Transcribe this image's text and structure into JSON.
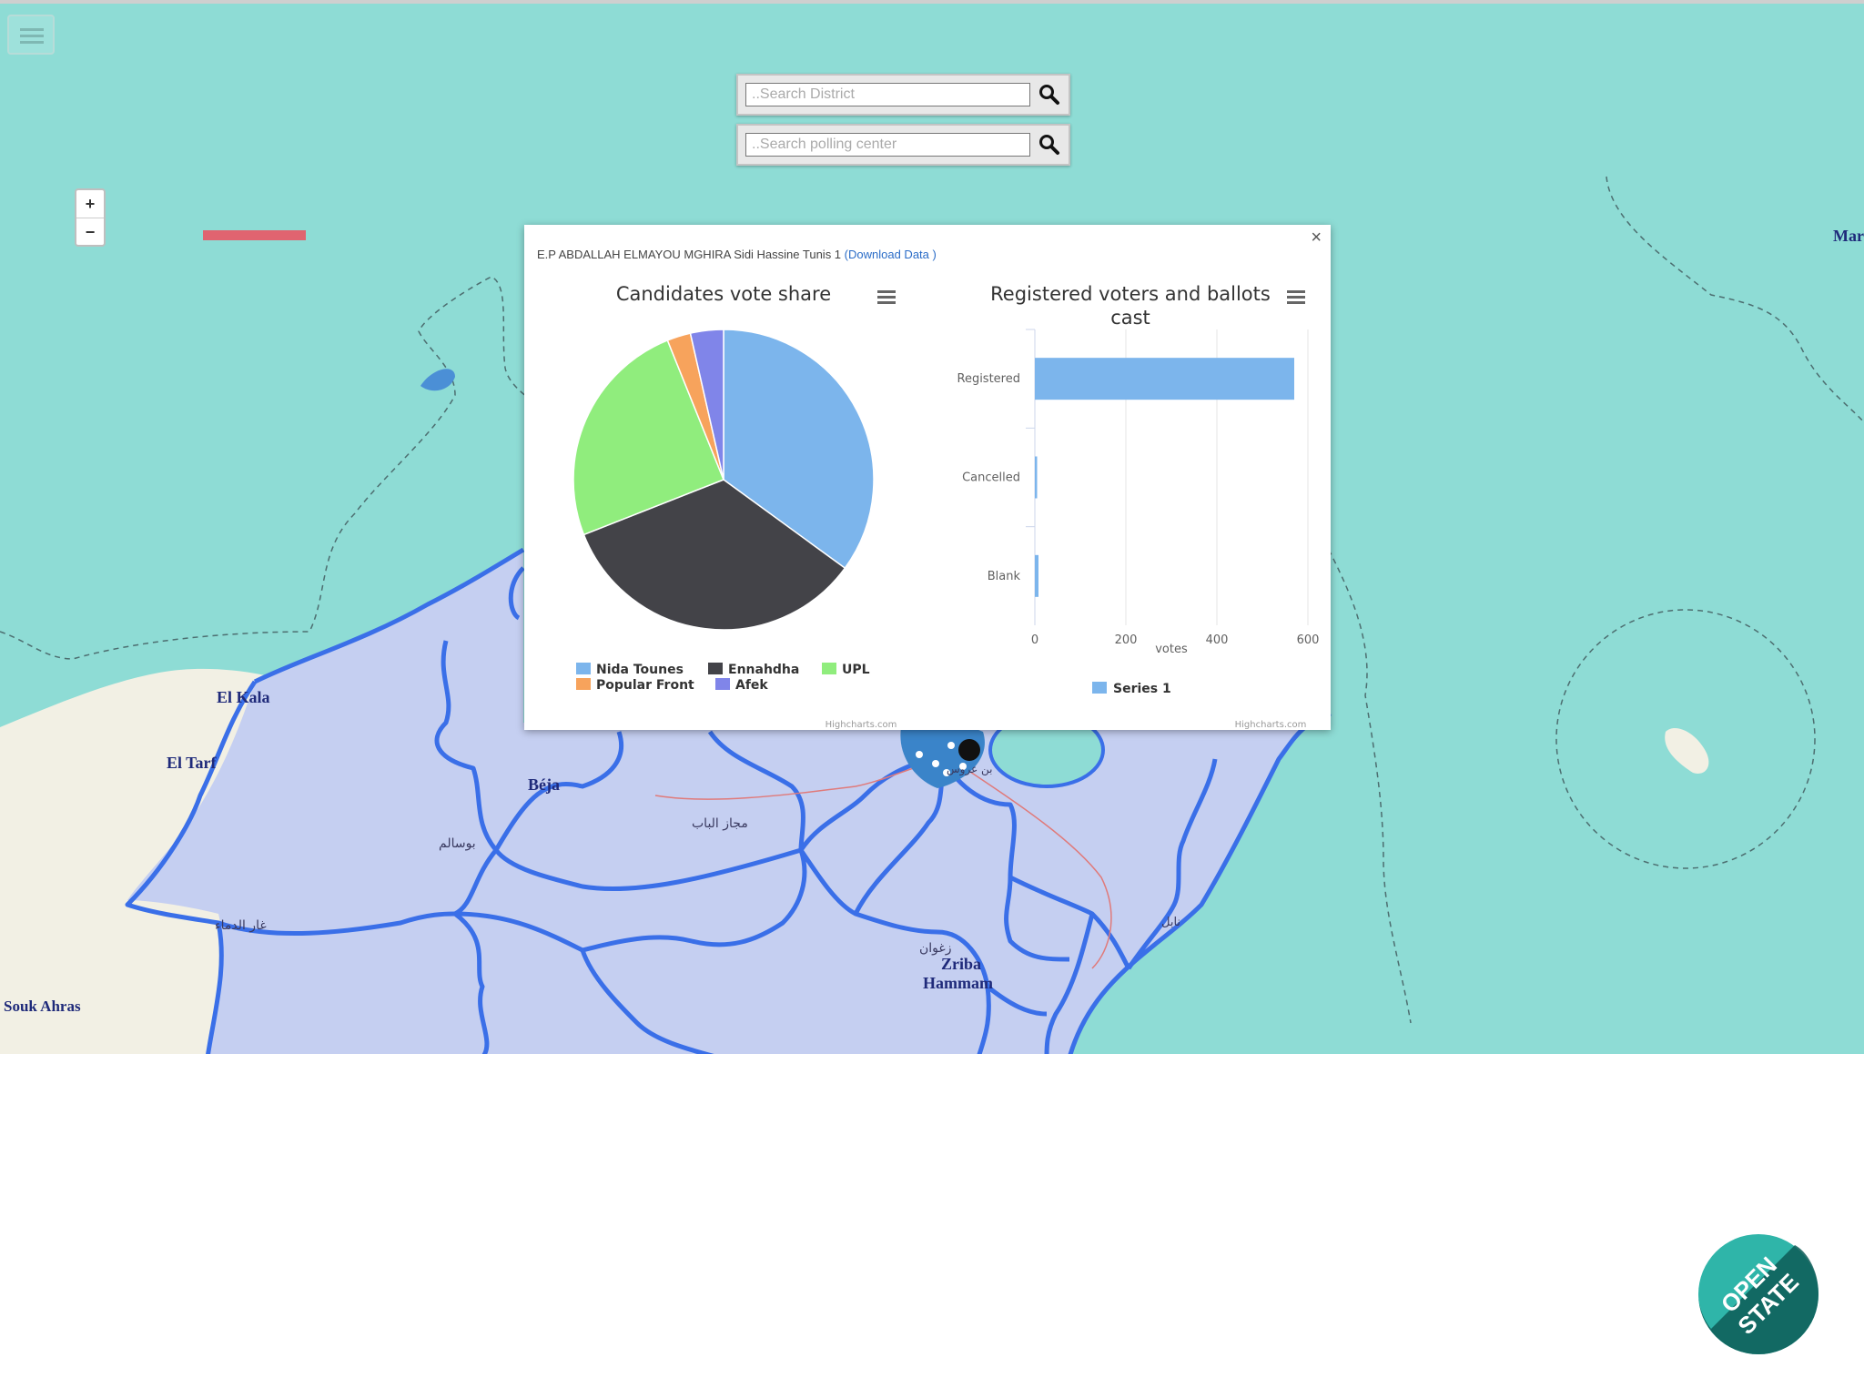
{
  "map": {
    "menu_icon": "hamburger-icon",
    "zoom_in": "+",
    "zoom_out": "−",
    "search_district_placeholder": "..Search District",
    "search_polling_placeholder": "..Search polling center",
    "search_icon": "magnifier-icon",
    "places": {
      "el_kala": "El Kala",
      "el_tarf": "El Tarf",
      "beja": "Béja",
      "souk_ahras": "Souk Ahras",
      "zriba": "Zriba",
      "hammam": "Hammam",
      "mar": "Mar",
      "bousalem": "بوسالم",
      "medjez": "مجاز الباب",
      "ghardimaou": "غار الدماء",
      "zaghouan": "زغوان",
      "ben_arous": "بن عروس",
      "nabeul": "نابل"
    }
  },
  "popup": {
    "title": "E.P ABDALLAH ELMAYOU MGHIRA Sidi Hassine Tunis 1",
    "download_link": "(Download Data )",
    "close": "×",
    "menu_icon": "chart-menu-icon",
    "credit": "Highcharts.com"
  },
  "chart_data": [
    {
      "type": "pie",
      "title": "Candidates vote share",
      "slices": [
        {
          "name": "Nida Tounes",
          "value": 34.5,
          "color": "#7cb5ec"
        },
        {
          "name": "Ennahdha",
          "value": 33.5,
          "color": "#434348"
        },
        {
          "name": "UPL",
          "value": 24.5,
          "color": "#90ed7d"
        },
        {
          "name": "Popular Front",
          "value": 2.5,
          "color": "#f7a35c"
        },
        {
          "name": "Afek",
          "value": 3.5,
          "color": "#8085e9"
        }
      ]
    },
    {
      "type": "bar",
      "title_line1": "Registered voters and ballots",
      "title_line2": "cast",
      "categories": [
        "Registered",
        "Cancelled",
        "Blank"
      ],
      "series": [
        {
          "name": "Series 1",
          "values": [
            570,
            5,
            8
          ],
          "color": "#7cb5ec"
        }
      ],
      "xlabel": "votes",
      "xlim": [
        0,
        600
      ],
      "ticks": [
        "0",
        "200",
        "400",
        "600"
      ],
      "grid": true,
      "legend": "bottom-center"
    }
  ],
  "branding": {
    "logo_line1": "OPEN",
    "logo_line2": "STATE"
  }
}
